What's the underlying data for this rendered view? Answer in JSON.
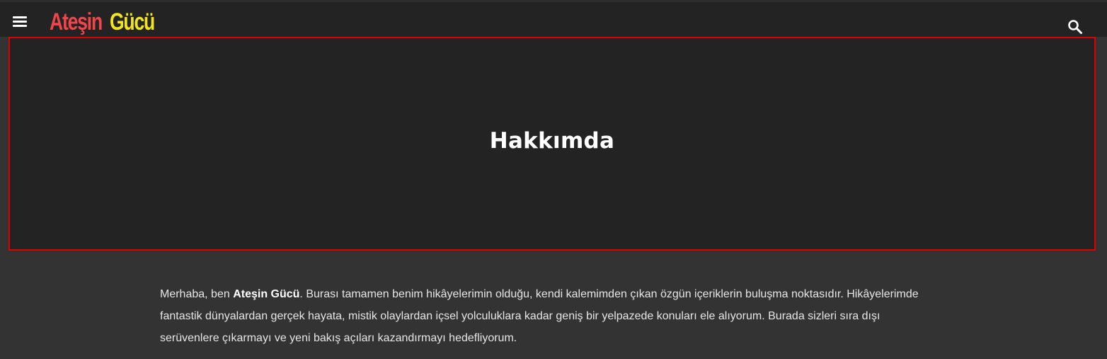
{
  "header": {
    "menu_icon": "hamburger-menu-icon",
    "logo_word1": "Ateşin",
    "logo_word2": "Gücü",
    "search_icon": "search-icon"
  },
  "hero": {
    "title": "Hakkımda"
  },
  "content": {
    "intro_prefix": "Merhaba, ben ",
    "intro_bold": "Ateşin Gücü",
    "intro_rest": ". Burası tamamen benim hikâyelerimin olduğu, kendi kalemimden çıkan özgün içeriklerin buluşma noktasıdır. Hikâyelerimde fantastik dünyalardan gerçek hayata, mistik olaylardan içsel yolculuklara kadar geniş bir yelpazede konuları ele alıyorum. Burada sizleri sıra dışı serüvenlere çıkarmayı ve yeni bakış açıları kazandırmayı hedefliyorum."
  },
  "colors": {
    "page_bg": "#333333",
    "bar_bg": "#232323",
    "logo_red": "#f0454b",
    "logo_yellow": "#f2e51f",
    "highlight_border": "#e00000"
  }
}
